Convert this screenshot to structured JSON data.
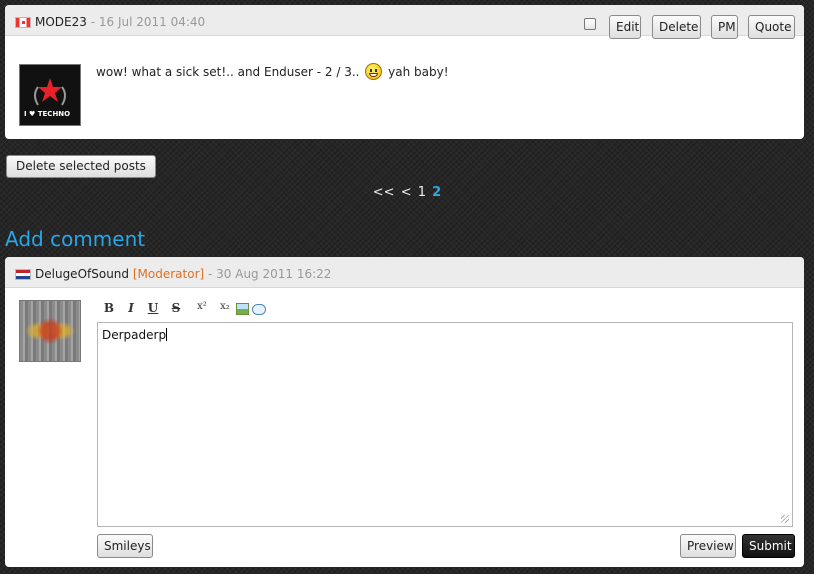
{
  "post": {
    "username": "MODE23",
    "date": "- 16 Jul 2011 04:40",
    "buttons": {
      "edit": "Edit",
      "delete": "Delete",
      "pm": "PM",
      "quote": "Quote"
    },
    "avatar_text": "I ♥ TECHNO",
    "text_before": "wow! what a sick set!.. and Enduser - 2 / 3..",
    "text_after": "yah baby!"
  },
  "delete_selected_label": "Delete selected posts",
  "pagination": {
    "first": "<<",
    "prev": "<",
    "pages": [
      "1",
      "2"
    ],
    "current": "2"
  },
  "add_comment": {
    "heading": "Add comment",
    "username": "DelugeOfSound",
    "role": "[Moderator]",
    "date": "- 30 Aug 2011 16:22",
    "toolbar": {
      "bold": "B",
      "italic": "I",
      "underline": "U",
      "strike": "S",
      "superscript": "x²",
      "subscript": "x₂"
    },
    "textarea_value": "Derpaderp",
    "buttons": {
      "smileys": "Smileys",
      "preview": "Preview",
      "submit": "Submit"
    }
  },
  "colors": {
    "accent": "#27a6e8",
    "moderator": "#e07020",
    "meta_gray": "#999999"
  }
}
